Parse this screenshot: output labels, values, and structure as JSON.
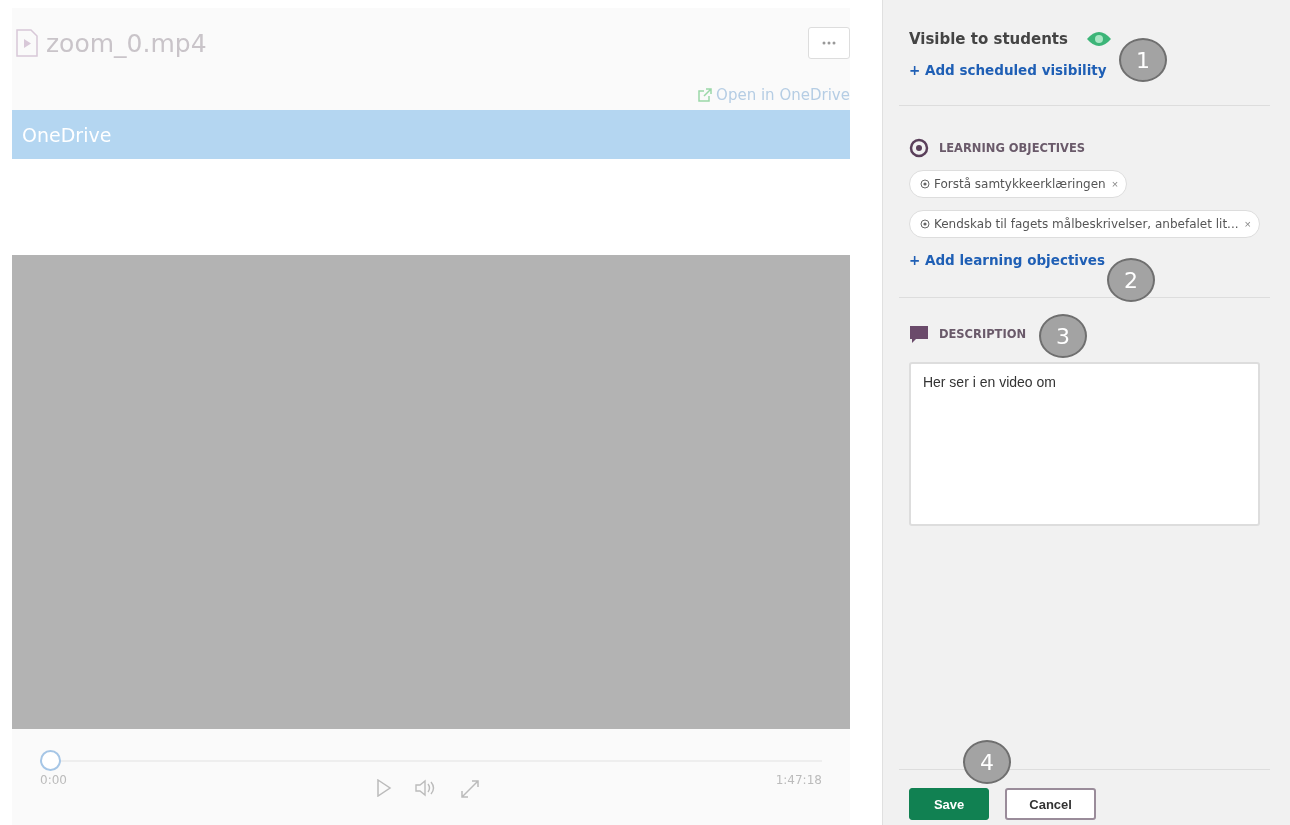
{
  "file": {
    "title": "zoom_0.mp4",
    "open_link": "Open in OneDrive",
    "banner": "OneDrive"
  },
  "player": {
    "progress": {
      "level": 0
    },
    "current_time": "0:00",
    "duration": "1:47:18"
  },
  "visibility": {
    "label": "Visible to students",
    "visible": true,
    "add_link": "+ Add scheduled visibility",
    "callout": "1"
  },
  "objectives": {
    "heading": "LEARNING OBJECTIVES",
    "tags": [
      {
        "label": "Forstå samtykkeerklæringen",
        "remove": "×"
      },
      {
        "label": "Kendskab til fagets målbeskrivelser, anbefalet lit...",
        "remove": "×"
      }
    ],
    "add_link": "+ Add learning objectives",
    "callout": "2"
  },
  "description": {
    "heading": "DESCRIPTION",
    "value": "Her ser i en video om",
    "callout": "3"
  },
  "footer": {
    "buttons": [
      {
        "label": "Save",
        "kind": "primary"
      },
      {
        "label": "Cancel",
        "kind": "secondary"
      }
    ],
    "callout": "4"
  }
}
